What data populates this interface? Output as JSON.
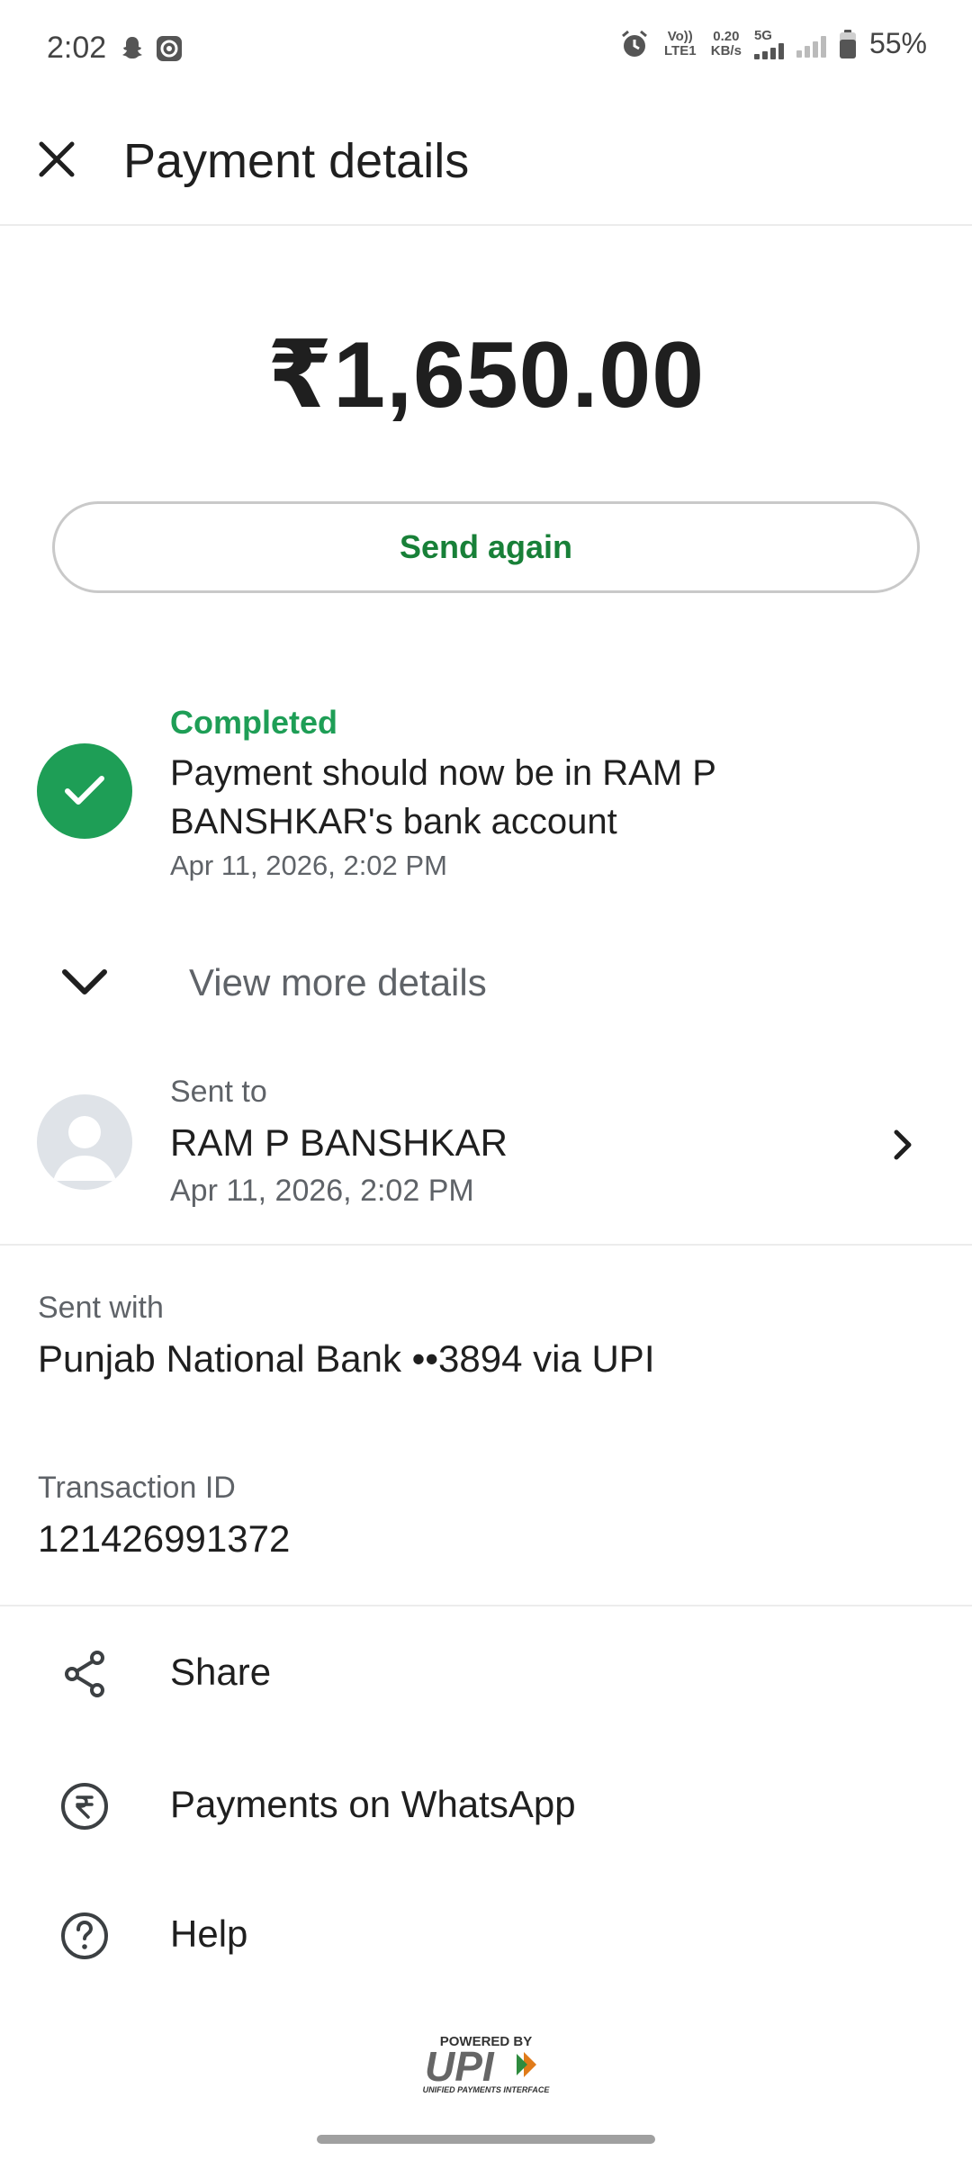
{
  "status_bar": {
    "time": "2:02",
    "volte": "Vo)) LTE1",
    "net_speed_value": "0.20",
    "net_speed_unit": "KB/s",
    "network": "5G",
    "battery": "55%"
  },
  "header": {
    "title": "Payment details"
  },
  "amount": "₹1,650.00",
  "send_again_label": "Send again",
  "payment_status": {
    "label": "Completed",
    "message": "Payment should now be in RAM P BANSHKAR's bank account",
    "datetime": "Apr 11, 2026, 2:02 PM"
  },
  "view_more_label": "View more details",
  "recipient": {
    "label": "Sent to",
    "name": "RAM P BANSHKAR",
    "datetime": "Apr 11, 2026, 2:02 PM"
  },
  "sent_with": {
    "label": "Sent with",
    "value": "Punjab National Bank ••3894 via UPI"
  },
  "transaction": {
    "label": "Transaction ID",
    "value": "121426991372"
  },
  "actions": [
    {
      "label": "Share",
      "icon": "share-icon"
    },
    {
      "label": "Payments on WhatsApp",
      "icon": "rupee-circle-icon"
    },
    {
      "label": "Help",
      "icon": "help-circle-icon"
    }
  ],
  "footer": {
    "powered_by": "POWERED BY",
    "logo_text": "UPI",
    "logo_subtitle": "UNIFIED PAYMENTS INTERFACE"
  },
  "colors": {
    "accent_green": "#1e9e56",
    "button_text_green": "#188038",
    "secondary_text": "#5f6368"
  }
}
